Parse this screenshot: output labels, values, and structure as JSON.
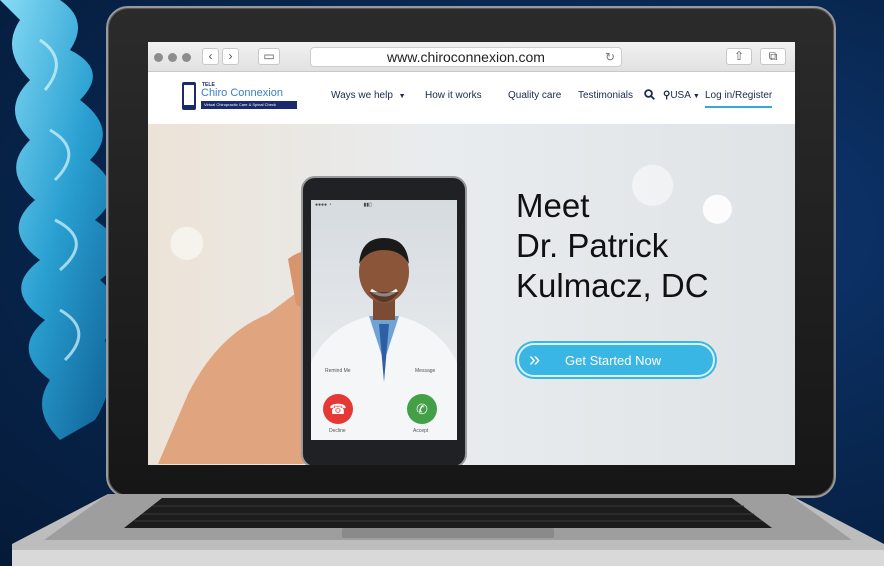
{
  "browser": {
    "url": "www.chiroconnexion.com",
    "back_icon": "chevron-left-icon",
    "forward_icon": "chevron-right-icon",
    "sidebar_icon": "sidebar-icon",
    "reload_icon": "reload-icon",
    "share_icon": "share-icon",
    "tabs_icon": "tabs-icon"
  },
  "site": {
    "logo": {
      "prefix": "TELE",
      "name": "Chiro Connexion",
      "tagline": "Virtual Chiropractic Care & Spinal Check"
    },
    "nav": {
      "ways": "Ways we help",
      "how": "How it works",
      "quality": "Quality care",
      "testimonials": "Testimonials",
      "country": "USA",
      "login": "Log in/Register"
    }
  },
  "hero": {
    "title_line1": "Meet",
    "title_line2": "Dr. Patrick",
    "title_line3": "Kulmacz, DC",
    "cta_label": "Get Started Now",
    "phone": {
      "decline_label": "Decline",
      "accept_label": "Accept",
      "remind_label": "Remind Me",
      "message_label": "Message"
    }
  },
  "colors": {
    "accent": "#39b6e3",
    "brand_navy": "#1b2a6b",
    "decline": "#e53935",
    "accept": "#43a047"
  }
}
